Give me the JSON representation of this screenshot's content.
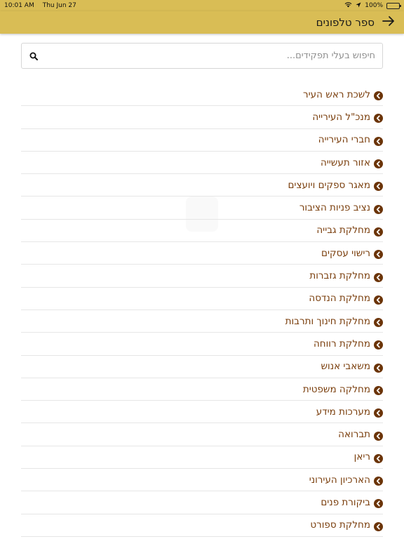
{
  "status_bar": {
    "time": "10:01 AM",
    "date": "Thu Jun 27",
    "battery": "100%"
  },
  "header": {
    "title": "ספר טלפונים"
  },
  "search": {
    "placeholder": "חיפוש בעלי תפקידים..."
  },
  "colors": {
    "header_bg": "#d9bd55",
    "item_text": "#7a3e0c",
    "icon": "#6b3408"
  },
  "list": {
    "items": [
      {
        "label": "לשכת ראש העיר"
      },
      {
        "label": "מנכ\"ל העירייה"
      },
      {
        "label": "חברי העירייה"
      },
      {
        "label": "אזור תעשייה"
      },
      {
        "label": "מאגר ספקים ויועצים"
      },
      {
        "label": "נציב פניות הציבור"
      },
      {
        "label": "מחלקת גבייה"
      },
      {
        "label": "רישוי עסקים"
      },
      {
        "label": "מחלקת גזברות"
      },
      {
        "label": "מחלקת הנדסה"
      },
      {
        "label": "מחלקת חינוך ותרבות"
      },
      {
        "label": "מחלקת רווחה"
      },
      {
        "label": "משאבי אנוש"
      },
      {
        "label": "מחלקה משפטית"
      },
      {
        "label": "מערכות מידע"
      },
      {
        "label": "תברואה"
      },
      {
        "label": "ריאן"
      },
      {
        "label": "הארכיון העירוני"
      },
      {
        "label": "ביקורת פנים"
      },
      {
        "label": "מחלקת ספורט"
      }
    ]
  }
}
